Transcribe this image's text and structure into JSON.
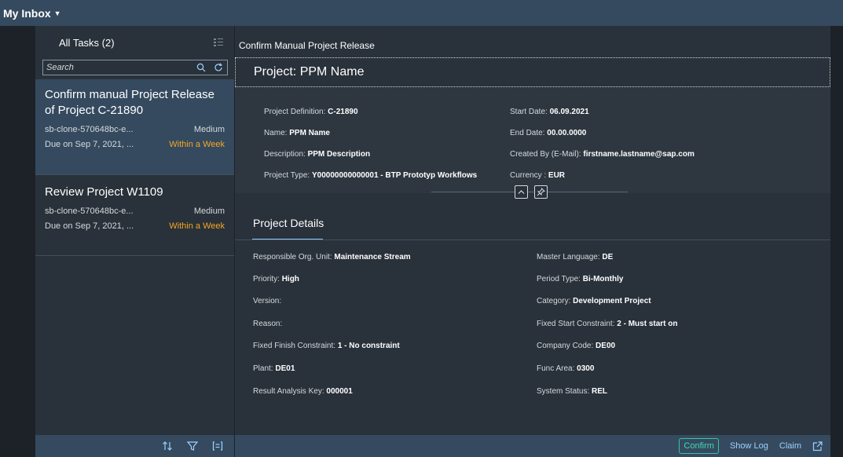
{
  "app": {
    "title": "My Inbox"
  },
  "master": {
    "header": "All Tasks (2)",
    "search_placeholder": "Search",
    "tasks": [
      {
        "title": "Confirm manual Project Release of Project C-21890",
        "creator": "sb-clone-570648bc-e...",
        "priority": "Medium",
        "due": "Due on Sep 7, 2021, ...",
        "status": "Within a Week"
      },
      {
        "title": "Review Project W1109",
        "creator": "sb-clone-570648bc-e...",
        "priority": "Medium",
        "due": "Due on Sep 7, 2021, ...",
        "status": "Within a Week"
      }
    ]
  },
  "detail": {
    "title": "Confirm Manual Project Release",
    "object_title": "Project: PPM Name",
    "header_fields": [
      {
        "label": "Project Definition:",
        "value": "C-21890"
      },
      {
        "label": "Name:",
        "value": "PPM Name"
      },
      {
        "label": "Description:",
        "value": "PPM Description"
      },
      {
        "label": "Project Type:",
        "value": "Y00000000000001 - BTP Prototyp Workflows"
      },
      {
        "label": "Start Date:",
        "value": "06.09.2021"
      },
      {
        "label": "End Date:",
        "value": "00.00.0000"
      },
      {
        "label": "Created By (E-Mail):",
        "value": "firstname.lastname@sap.com"
      },
      {
        "label": "Currency :",
        "value": "EUR"
      }
    ],
    "section_title": "Project Details",
    "details": [
      {
        "label": "Responsible Org. Unit:",
        "value": "Maintenance Stream"
      },
      {
        "label": "Priority:",
        "value": "High"
      },
      {
        "label": "Version:",
        "value": ""
      },
      {
        "label": "Reason:",
        "value": ""
      },
      {
        "label": "Fixed Finish Constraint:",
        "value": "1 - No constraint"
      },
      {
        "label": "Plant:",
        "value": "DE01"
      },
      {
        "label": "Result Analysis Key:",
        "value": "000001"
      },
      {
        "label": "Master Language:",
        "value": "DE"
      },
      {
        "label": "Period Type:",
        "value": "Bi-Monthly"
      },
      {
        "label": "Category:",
        "value": "Development Project"
      },
      {
        "label": "Fixed Start Constraint:",
        "value": "2 - Must start on"
      },
      {
        "label": "Company Code:",
        "value": "DE00"
      },
      {
        "label": "Func Area:",
        "value": "0300"
      },
      {
        "label": "System Status:",
        "value": "REL"
      }
    ],
    "footer": {
      "confirm": "Confirm",
      "show_log": "Show Log",
      "claim": "Claim"
    }
  }
}
